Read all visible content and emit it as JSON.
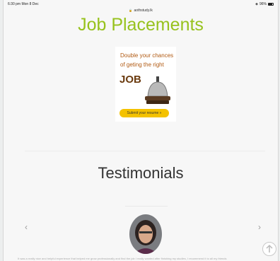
{
  "status": {
    "time": "6:30 pm  Mon 8 Dec",
    "battery": "96%"
  },
  "browser": {
    "url": "aothstudy.lk"
  },
  "placements": {
    "title": "Job Placements",
    "ad": {
      "line1": "Double your chances",
      "line2": "of geting the right",
      "job": "JOB",
      "cta": "Submit your resume »"
    }
  },
  "testimonials": {
    "title": "Testimonials",
    "prev": "‹",
    "next": "›",
    "quote": "It was a really nice and helpful experience that helped me grow professionally and find the job I really wanted after finishing my studies, I recommend it to all my friends"
  },
  "icons": [
    "wifi-icon",
    "battery-icon",
    "lock-icon",
    "bell-icon",
    "avatar-image",
    "chevron-left-icon",
    "chevron-right-icon",
    "upload-icon"
  ]
}
